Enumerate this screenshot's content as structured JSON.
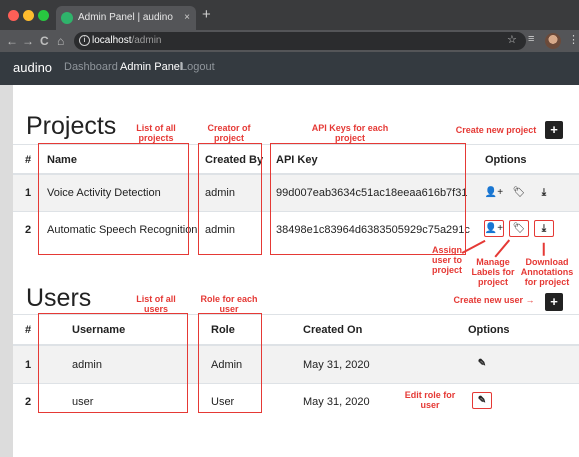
{
  "browser": {
    "tab_title": "Admin Panel | audino",
    "tab_close": "×",
    "new_tab": "+",
    "url_host": "localhost",
    "url_path": "/admin",
    "nav_back": "←",
    "nav_forward": "→",
    "nav_reload": "C",
    "nav_home": "⌂",
    "star": "☆",
    "extensions": "≡",
    "menu": "⋮"
  },
  "app": {
    "brand": "audino",
    "nav": [
      "Dashboard",
      "Admin Panel",
      "Logout"
    ]
  },
  "projects": {
    "title": "Projects",
    "headers": [
      "#",
      "Name",
      "Created By",
      "API Key",
      "Options"
    ],
    "rows": [
      {
        "id": "1",
        "name": "Voice Activity Detection",
        "created_by": "admin",
        "api_key": "99d007eab3634c51ac18eeaa616b7f31"
      },
      {
        "id": "2",
        "name": "Automatic Speech Recognition",
        "created_by": "admin",
        "api_key": "38498e1c83964d6383505929c75a291c"
      }
    ],
    "annotations": {
      "name": "List of all projects",
      "created_by": "Creator of project",
      "api_key": "API Keys for each project",
      "create": "Create new project",
      "assign": "Assign user to project",
      "labels": "Manage Labels for project",
      "download": "Download Annotations for project"
    }
  },
  "users": {
    "title": "Users",
    "headers": [
      "#",
      "Username",
      "Role",
      "Created On",
      "Options"
    ],
    "rows": [
      {
        "id": "1",
        "username": "admin",
        "role": "Admin",
        "created_on": "May 31, 2020"
      },
      {
        "id": "2",
        "username": "user",
        "role": "User",
        "created_on": "May 31, 2020"
      }
    ],
    "annotations": {
      "username": "List of all users",
      "role": "Role for each user",
      "create": "Create new user →",
      "edit": "Edit role for user"
    }
  },
  "icons": {
    "add": "+",
    "assign": "👤+",
    "labels": "🏷",
    "download": "⤓",
    "edit": "✎"
  },
  "colors": {
    "annotation": "#e53935",
    "navbar": "#343a40",
    "stripe": "#f2f2f2"
  }
}
